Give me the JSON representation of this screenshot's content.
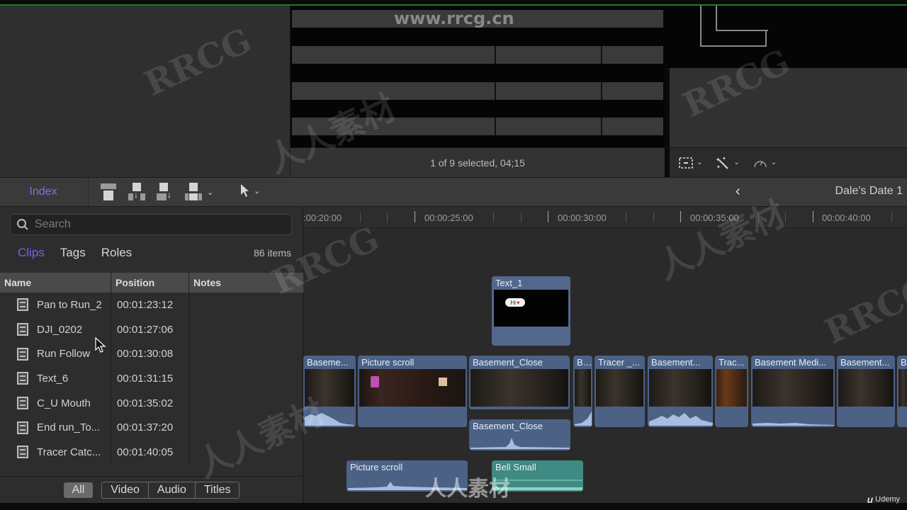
{
  "viewer": {
    "status": "1 of 9 selected, 04;15"
  },
  "inspector_tools": [
    {
      "name": "transform",
      "icon": "crop-frame-icon"
    },
    {
      "name": "enhance",
      "icon": "magic-wand-icon"
    },
    {
      "name": "retime",
      "icon": "speedometer-icon"
    }
  ],
  "toolbar": {
    "index_label": "Index",
    "project_title": "Dale's Date 1",
    "edit_tools": [
      "connect-clip",
      "insert-clip",
      "append-clip",
      "overwrite-clip"
    ],
    "select_tool": "arrow-select"
  },
  "index": {
    "search_placeholder": "Search",
    "tabs": [
      {
        "label": "Clips",
        "active": true
      },
      {
        "label": "Tags",
        "active": false
      },
      {
        "label": "Roles",
        "active": false
      }
    ],
    "items_count": "86 items",
    "columns": [
      "Name",
      "Position",
      "Notes"
    ],
    "rows": [
      {
        "name": "Pan to Run_2",
        "position": "00:01:23:12",
        "notes": ""
      },
      {
        "name": "DJI_0202",
        "position": "00:01:27:06",
        "notes": ""
      },
      {
        "name": "Run Follow",
        "position": "00:01:30:08",
        "notes": ""
      },
      {
        "name": "Text_6",
        "position": "00:01:31:15",
        "notes": ""
      },
      {
        "name": "C_U Mouth",
        "position": "00:01:35:02",
        "notes": ""
      },
      {
        "name": "End run_To...",
        "position": "00:01:37:20",
        "notes": ""
      },
      {
        "name": "Tracer Catc...",
        "position": "00:01:40:05",
        "notes": ""
      }
    ],
    "filters": [
      {
        "label": "All",
        "active": true
      },
      {
        "label": "Video",
        "active": false
      },
      {
        "label": "Audio",
        "active": false
      },
      {
        "label": "Titles",
        "active": false
      }
    ]
  },
  "timeline": {
    "ruler": [
      {
        "label": ":00:20:00"
      },
      {
        "label": "00:00:25:00"
      },
      {
        "label": "00:00:30:00"
      },
      {
        "label": "00:00:35:00"
      },
      {
        "label": "00:00:40:00"
      }
    ],
    "title_clips": [
      {
        "label": "Text_1",
        "bubble_text": "Hi"
      }
    ],
    "video_clips": [
      {
        "label": "Baseme..."
      },
      {
        "label": "Picture scroll"
      },
      {
        "label": "Basement_Close"
      },
      {
        "label": "B..."
      },
      {
        "label": "Tracer _..."
      },
      {
        "label": "Basement..."
      },
      {
        "label": "Trac..."
      },
      {
        "label": "Basement Medi..."
      },
      {
        "label": "Basement..."
      },
      {
        "label": "B"
      }
    ],
    "audio_clips": [
      {
        "label": "Basement_Close"
      },
      {
        "label": "Picture scroll"
      },
      {
        "label": "Bell Small"
      }
    ]
  },
  "watermarks": {
    "url": "www.rrcg.cn",
    "brand": "RRCG",
    "cn": "人人素材",
    "udemy": "Udemy"
  }
}
